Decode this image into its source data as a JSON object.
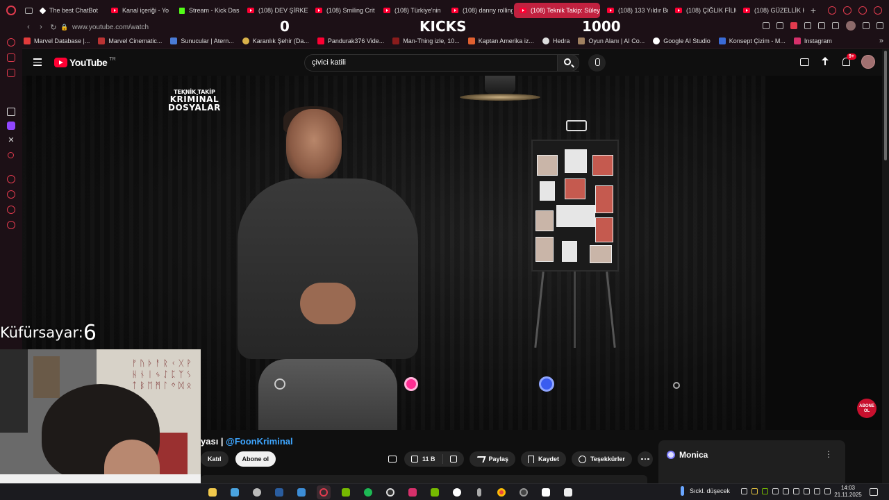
{
  "browser": {
    "tabs": [
      {
        "label": "The best ChatBot",
        "icon": "chat-icon",
        "active": false
      },
      {
        "label": "Kanal içeriği - Yo",
        "icon": "youtube-icon",
        "active": false
      },
      {
        "label": "Stream - Kick Das",
        "icon": "kick-icon",
        "active": false
      },
      {
        "label": "(108) DEV ŞİRKET",
        "icon": "youtube-icon",
        "active": false
      },
      {
        "label": "(108) Smiling Crit",
        "icon": "youtube-icon",
        "active": false
      },
      {
        "label": "(108) Türkiye'nin",
        "icon": "youtube-icon",
        "active": false
      },
      {
        "label": "(108) danny rolling",
        "icon": "youtube-icon",
        "active": false
      },
      {
        "label": "(108) Teknik Takip: Süley",
        "icon": "youtube-icon",
        "active": true
      },
      {
        "label": "(108) 133 Yıldır Bu",
        "icon": "youtube-icon",
        "active": false
      },
      {
        "label": "(108) ÇIĞLIK FİLM",
        "icon": "youtube-icon",
        "active": false
      },
      {
        "label": "(108) GÜZELLİK K",
        "icon": "youtube-icon",
        "active": false
      }
    ],
    "url": "www.youtube.com/watch",
    "bookmarks": [
      "Marvel Database |...",
      "Marvel Cinematic...",
      "Sunucular | Atern...",
      "Karanlık Şehir (Da...",
      "Pandurak376 Vide...",
      "Man-Thing izle, 10...",
      "Kaptan Amerika iz...",
      "Hedra",
      "Oyun Alanı | AI Co...",
      "Google AI Studio",
      "Konsept Çizim - M...",
      "Instagram"
    ]
  },
  "stream_overlay": {
    "left_count": "0",
    "center_label": "KICKS",
    "right_count": "1000",
    "swear_label": "Küfürsayar:",
    "swear_count": "6"
  },
  "youtube": {
    "logo_text": "YouTube",
    "country": "TR",
    "search_value": "çivici katili",
    "notification_badge": "9+",
    "video": {
      "watermark_small": "TEKNİK TAKİP",
      "watermark_line1": "KRİMİNAL",
      "watermark_line2": "DOSYALAR",
      "subscribe_overlay_1": "ABONE",
      "subscribe_overlay_2": "OL"
    },
    "title_fragment": "yası | ",
    "channel_handle": "@FoonKriminal",
    "join_label": "Katıl",
    "subscribe_label": "Abone ol",
    "like_count": "11 B",
    "share_label": "Paylaş",
    "save_label": "Kaydet",
    "thanks_label": "Teşekkürler"
  },
  "monica": {
    "name": "Monica"
  },
  "taskbar": {
    "weather": "Sıckl. düşecek",
    "time": "14:03",
    "date": "21.11.2025"
  },
  "colors": {
    "accent": "#c1213f",
    "youtube_red": "#ff0033",
    "link_blue": "#3ea6ff",
    "kick_green": "#53fc18"
  }
}
